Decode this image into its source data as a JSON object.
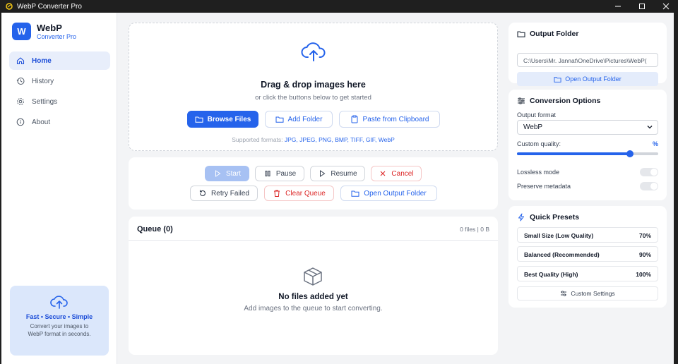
{
  "window": {
    "title": "WebP Converter Pro"
  },
  "brand": {
    "name": "WebP",
    "logo_letter": "W",
    "subtitle": "Converter Pro"
  },
  "nav": [
    {
      "label": "Home",
      "icon": "home-icon",
      "active": true
    },
    {
      "label": "History",
      "icon": "history-icon",
      "active": false
    },
    {
      "label": "Settings",
      "icon": "gear-icon",
      "active": false
    },
    {
      "label": "About",
      "icon": "info-icon",
      "active": false
    }
  ],
  "promo": {
    "title": "Fast • Secure • Simple",
    "text": "Convert your images to WebP format in seconds."
  },
  "dropzone": {
    "title": "Drag & drop images here",
    "subtitle": "or click the buttons below to get started",
    "browse_label": "Browse Files",
    "add_folder_label": "Add Folder",
    "paste_label": "Paste from Clipboard",
    "formats_prefix": "Supported formats: ",
    "formats_list": "JPG, JPEG, PNG, BMP, TIFF, GIF, WebP"
  },
  "controls": {
    "start": "Start",
    "pause": "Pause",
    "resume": "Resume",
    "cancel": "Cancel",
    "retry": "Retry Failed",
    "clear": "Clear Queue",
    "open_output": "Open Output Folder"
  },
  "queue": {
    "title": "Queue (0)",
    "stats": "0 files | 0 B",
    "empty_title": "No files added yet",
    "empty_subtitle": "Add images to the queue to start converting."
  },
  "output_folder": {
    "title": "Output Folder",
    "path": "C:\\Users\\Mr. Jannat\\OneDrive\\Pictures\\WebP(",
    "open_label": "Open Output Folder"
  },
  "conversion": {
    "title": "Conversion Options",
    "format_label": "Output format",
    "format_value": "WebP",
    "quality_label": "Custom quality:",
    "quality_unit": "%",
    "quality_fraction": 0.8,
    "lossless_label": "Lossless mode",
    "lossless_on": false,
    "metadata_label": "Preserve metadata",
    "metadata_on": false
  },
  "presets": {
    "title": "Quick Presets",
    "items": [
      {
        "name": "Small Size (Low Quality)",
        "value": "70%"
      },
      {
        "name": "Balanced (Recommended)",
        "value": "90%"
      },
      {
        "name": "Best Quality (High)",
        "value": "100%"
      }
    ],
    "custom_label": "Custom Settings"
  },
  "colors": {
    "accent": "#2563eb",
    "danger": "#dc2626"
  }
}
